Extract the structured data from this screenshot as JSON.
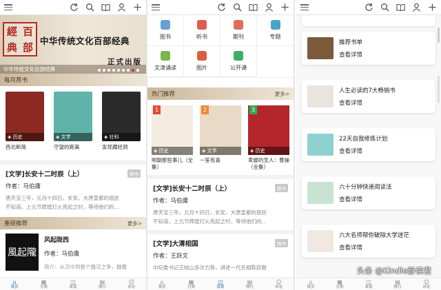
{
  "panel1": {
    "banner": {
      "seal_chars": [
        "經",
        "百",
        "典",
        "部"
      ],
      "title": "中华传统文化百部经典",
      "subtitle": "正式出版",
      "caption": "中华传统文化百部经典"
    },
    "monthly": {
      "heading": "每月荐书",
      "books": [
        {
          "title": "西北断简",
          "tag": "历史",
          "color": "#8c2a22"
        },
        {
          "title": "守望的距离",
          "tag": "文学",
          "color": "#5fb3a8"
        },
        {
          "title": "发现藏经洞",
          "tag": "社科",
          "color": "#2b2b2b"
        }
      ]
    },
    "article": {
      "title": "[文学]长安十二时辰（上）",
      "badge": "图书",
      "author": "作者：马伯庸",
      "line1": "唐天宝三年，元月十四日，长安。大唐皇都的居民",
      "line2": "不知道，上元节辉煌灯火亮起之时，等待他们的…"
    },
    "featured": {
      "heading": "重磅推荐",
      "more": "更多>",
      "title": "风起陇西",
      "author": "作者：马伯庸",
      "body": "简介：从汉中到整个魏汉之争，魏蜀",
      "cover_text": "風起隴"
    }
  },
  "panel2": {
    "categories": [
      {
        "label": "图书",
        "color": "#6a9fd4"
      },
      {
        "label": "听书",
        "color": "#e05b4b"
      },
      {
        "label": "期刊",
        "color": "#e26c5a"
      },
      {
        "label": "专题",
        "color": "#4aa3c9"
      },
      {
        "label": "文津诵读",
        "color": "#78b84e"
      },
      {
        "label": "图片",
        "color": "#d8623f"
      },
      {
        "label": "公开课",
        "color": "#3eae67"
      }
    ],
    "hot": {
      "heading": "热门推荐",
      "more": "更多>",
      "books": [
        {
          "num": "1",
          "num_color": "#e14a3c",
          "tag": "历史",
          "title": "明朝那些事儿（全集）",
          "color": "#f4ece0"
        },
        {
          "num": "2",
          "num_color": "#f0873a",
          "tag": "文学",
          "title": "一笙有喜",
          "color": "#e9d9c7"
        },
        {
          "num": "3",
          "num_color": "#32a852",
          "tag": "历史",
          "title": "卑鄙的圣人：曹操（全集）",
          "color": "#b5262c"
        }
      ]
    },
    "article1": {
      "title": "[文学]长安十二时辰（上）",
      "badge": "图书",
      "author": "作者：马伯庸",
      "line1": "唐天宝三年，元月十四日，长安。大唐皇都的居民",
      "line2": "不知道，上元节辉煌灯火亮起之时，等待他们的…"
    },
    "article2": {
      "title": "[文学]大清相国",
      "badge": "图书",
      "author": "作者：王跃文",
      "line1": "中纪委书记王岐山多次力荐，讲述一代名相陈廷敬"
    }
  },
  "panel3": {
    "cards": [
      {
        "title": "推荐书单",
        "link": "查看详情",
        "thumb": "#7a5a3a"
      },
      {
        "title": "人生必读的7大畅销书",
        "link": "查看详情",
        "thumb": "#e9e4de"
      },
      {
        "title": "22天自我修炼计划",
        "link": "查看详情",
        "thumb": "#8fd1cf"
      },
      {
        "title": "六十分钟快速阅读法",
        "link": "查看详情",
        "thumb": "#c9e3d3"
      },
      {
        "title": "六大名师帮你破除大学迷茫",
        "link": "查看详情",
        "thumb": "#f1e9e1"
      }
    ]
  },
  "nav": {
    "items": [
      {
        "label": "首页",
        "icon": "home-icon"
      },
      {
        "label": "分类",
        "icon": "category-icon"
      },
      {
        "label": "发现",
        "icon": "discover-icon"
      },
      {
        "label": "排行",
        "icon": "rank-icon"
      },
      {
        "label": "评论",
        "icon": "comment-icon"
      }
    ],
    "active_panel1": 0,
    "active_panel2": 2,
    "active_color": "#2a6cc2"
  },
  "watermark": "头条 @Kindle静读君"
}
